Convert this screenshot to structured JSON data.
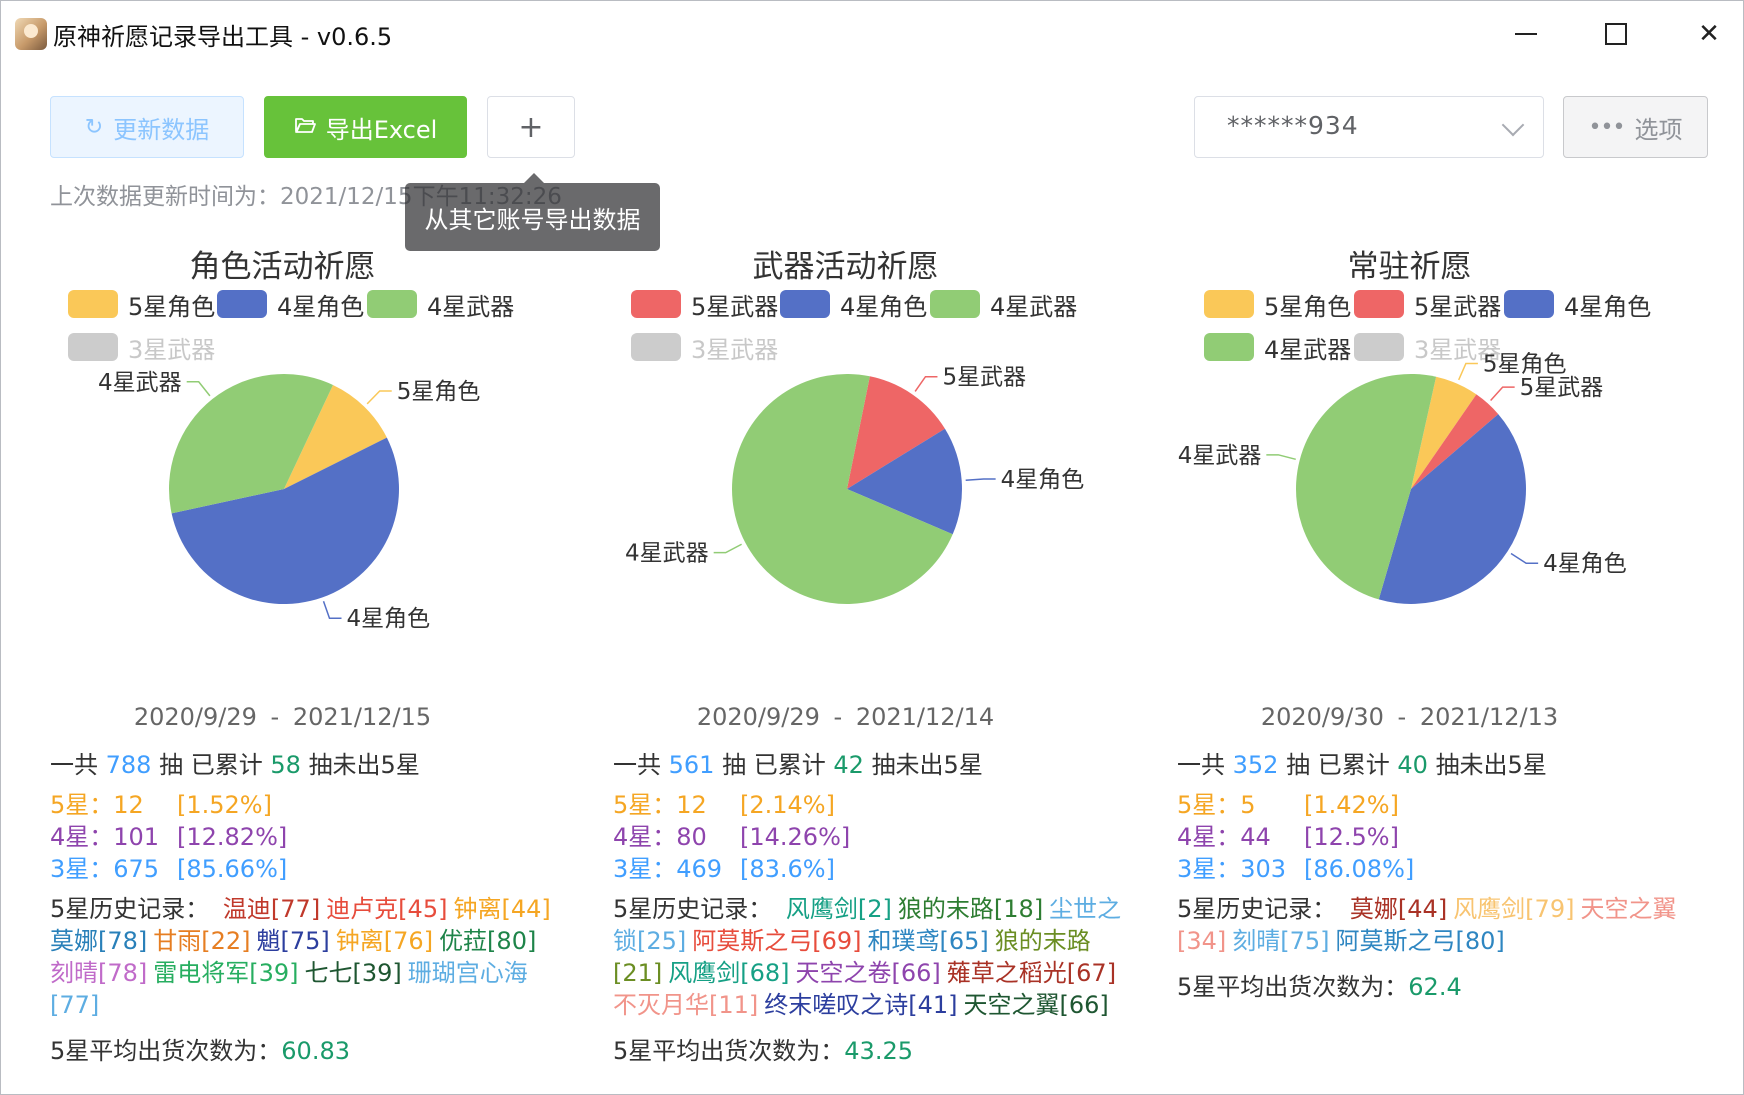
{
  "window": {
    "title": "原神祈愿记录导出工具 - v0.6.5"
  },
  "toolbar": {
    "refresh_label": "更新数据",
    "export_label": "导出Excel",
    "add_label": "+",
    "account_value": "******934",
    "options_label": "选项"
  },
  "status": {
    "last_update": "上次数据更新时间为：2021/12/15下午11:32:26"
  },
  "tooltip": {
    "text": "从其它账号导出数据"
  },
  "colors": {
    "5星角色": "#fac858",
    "4星角色": "#5470c6",
    "4星武器": "#91cc75",
    "5星武器": "#ee6666",
    "3星武器": "#cccccc"
  },
  "panels": [
    {
      "summary_prefix": "一共",
      "summary_total": "788",
      "summary_mid": "抽 已累计",
      "summary_pity": "58",
      "summary_suffix": "抽未出5星",
      "r5_label": "5星：12",
      "r5_pct": "[1.52%]",
      "r4_label": "4星：101",
      "r4_pct": "[12.82%]",
      "r3_label": "3星：675",
      "r3_pct": "[85.66%]",
      "history_label": "5星历史记录：",
      "history": [
        {
          "text": "温迪[77]",
          "color": "#c0392b"
        },
        {
          "text": "迪卢克[45]",
          "color": "#e74c3c"
        },
        {
          "text": "钟离[44]",
          "color": "#f5a623"
        },
        {
          "text": "莫娜[78]",
          "color": "#2980b9"
        },
        {
          "text": "甘雨[22]",
          "color": "#e67e22"
        },
        {
          "text": "魈[75]",
          "color": "#2c3e9e"
        },
        {
          "text": "钟离[76]",
          "color": "#f5a623"
        },
        {
          "text": "优菈[80]",
          "color": "#1e8449"
        },
        {
          "text": "刻晴[78]",
          "color": "#c06bc9"
        },
        {
          "text": "雷电将军[39]",
          "color": "#27ae60"
        },
        {
          "text": "七七[39]",
          "color": "#1e5631"
        },
        {
          "text": "珊瑚宫心海[77]",
          "color": "#5dade2"
        }
      ],
      "avg_label": "5星平均出货次数为：",
      "avg_value": "60.83"
    },
    {
      "summary_prefix": "一共",
      "summary_total": "561",
      "summary_mid": "抽 已累计",
      "summary_pity": "42",
      "summary_suffix": "抽未出5星",
      "r5_label": "5星：12",
      "r5_pct": "[2.14%]",
      "r4_label": "4星：80",
      "r4_pct": "[14.26%]",
      "r3_label": "3星：469",
      "r3_pct": "[83.6%]",
      "history_label": "5星历史记录：",
      "history": [
        {
          "text": "风鹰剑[2]",
          "color": "#16a085"
        },
        {
          "text": "狼的末路[18]",
          "color": "#2e7d32"
        },
        {
          "text": "尘世之锁[25]",
          "color": "#5dade2"
        },
        {
          "text": "阿莫斯之弓[69]",
          "color": "#e74c3c"
        },
        {
          "text": "和璞鸢[65]",
          "color": "#2e86c1"
        },
        {
          "text": "狼的末路[21]",
          "color": "#6b8e23"
        },
        {
          "text": "风鹰剑[68]",
          "color": "#16a085"
        },
        {
          "text": "天空之卷[66]",
          "color": "#8e44ad"
        },
        {
          "text": "薙草之稻光[67]",
          "color": "#a93226"
        },
        {
          "text": "不灭月华[11]",
          "color": "#f1948a"
        },
        {
          "text": "终末嗟叹之诗[41]",
          "color": "#2c3e9e"
        },
        {
          "text": "天空之翼[66]",
          "color": "#1e5631"
        }
      ],
      "avg_label": "5星平均出货次数为：",
      "avg_value": "43.25"
    },
    {
      "summary_prefix": "一共",
      "summary_total": "352",
      "summary_mid": "抽 已累计",
      "summary_pity": "40",
      "summary_suffix": "抽未出5星",
      "r5_label": "5星：5",
      "r5_pct": "[1.42%]",
      "r4_label": "4星：44",
      "r4_pct": "[12.5%]",
      "r3_label": "3星：303",
      "r3_pct": "[86.08%]",
      "history_label": "5星历史记录：",
      "history": [
        {
          "text": "莫娜[44]",
          "color": "#a93226"
        },
        {
          "text": "风鹰剑[79]",
          "color": "#f8c471"
        },
        {
          "text": "天空之翼[34]",
          "color": "#f1948a"
        },
        {
          "text": "刻晴[75]",
          "color": "#5dade2"
        },
        {
          "text": "阿莫斯之弓[80]",
          "color": "#2e86c1"
        }
      ],
      "avg_label": "5星平均出货次数为：",
      "avg_value": "62.4"
    }
  ],
  "chart_data": [
    {
      "type": "pie",
      "title": "角色活动祈愿",
      "legend": [
        "5星角色",
        "4星角色",
        "4星武器",
        "3星武器"
      ],
      "legend_disabled": [
        "3星武器"
      ],
      "slices": [
        {
          "name": "5星角色",
          "value": 12
        },
        {
          "name": "4星角色",
          "value": 61
        },
        {
          "name": "4星武器",
          "value": 40
        }
      ],
      "date_start": "2020/9/29",
      "date_sep": "-",
      "date_end": "2021/12/15"
    },
    {
      "type": "pie",
      "title": "武器活动祈愿",
      "legend": [
        "5星武器",
        "4星角色",
        "4星武器",
        "3星武器"
      ],
      "legend_disabled": [
        "3星武器"
      ],
      "slices": [
        {
          "name": "5星武器",
          "value": 12
        },
        {
          "name": "4星角色",
          "value": 14
        },
        {
          "name": "4星武器",
          "value": 66
        }
      ],
      "date_start": "2020/9/29",
      "date_sep": "-",
      "date_end": "2021/12/14"
    },
    {
      "type": "pie",
      "title": "常驻祈愿",
      "legend": [
        "5星角色",
        "5星武器",
        "4星角色",
        "4星武器",
        "3星武器"
      ],
      "legend_disabled": [
        "3星武器"
      ],
      "slices": [
        {
          "name": "5星角色",
          "value": 3
        },
        {
          "name": "5星武器",
          "value": 2
        },
        {
          "name": "4星角色",
          "value": 20
        },
        {
          "name": "4星武器",
          "value": 24
        }
      ],
      "date_start": "2020/9/30",
      "date_sep": "-",
      "date_end": "2021/12/13"
    }
  ]
}
